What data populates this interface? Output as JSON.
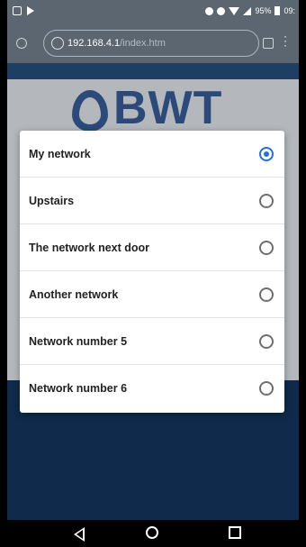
{
  "status_bar": {
    "battery_text": "95%",
    "time": "09:"
  },
  "browser": {
    "url_host": "192.168.4.1",
    "url_path": "/index.htm"
  },
  "page": {
    "logo_text": "BWT"
  },
  "dialog": {
    "options": [
      {
        "label": "My network",
        "checked": true
      },
      {
        "label": "Upstairs",
        "checked": false
      },
      {
        "label": "The network next door",
        "checked": false
      },
      {
        "label": "Another network",
        "checked": false
      },
      {
        "label": "Network number 5",
        "checked": false
      },
      {
        "label": "Network number 6",
        "checked": false
      }
    ]
  },
  "colors": {
    "accent": "#2a6fdb",
    "brand": "#2b4a7a"
  },
  "icons": {
    "nav_back": "back-triangle-icon",
    "nav_home": "home-circle-icon",
    "nav_recent": "recent-square-icon"
  }
}
